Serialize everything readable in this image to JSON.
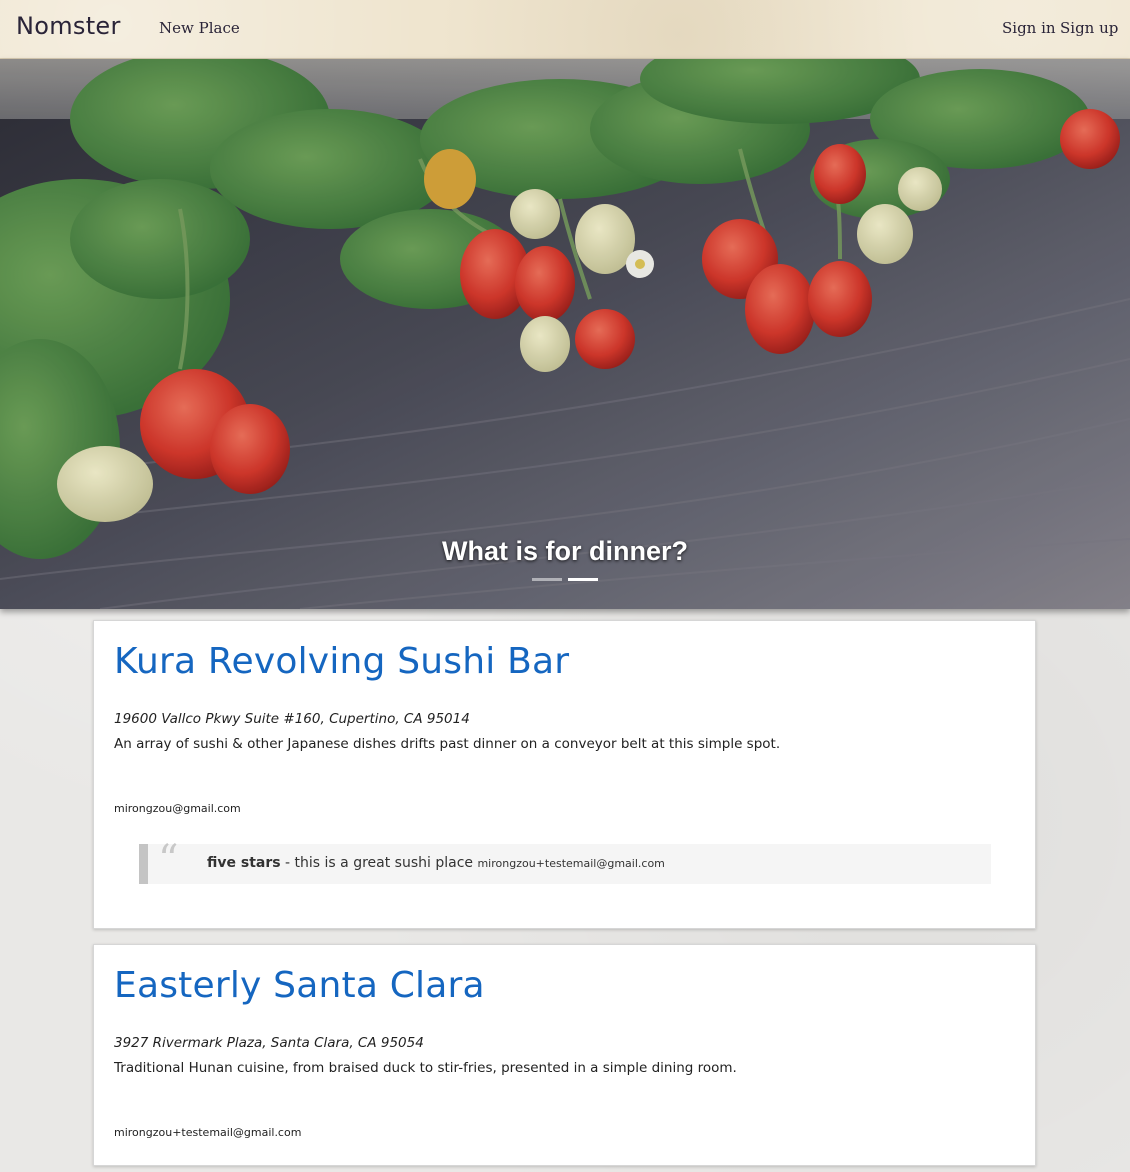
{
  "nav": {
    "brand": "Nomster",
    "new_place": "New Place",
    "sign_in": "Sign in",
    "sign_up": "Sign up"
  },
  "hero": {
    "caption": "What is for dinner?",
    "slide_count": 2,
    "active_slide": 2
  },
  "places": [
    {
      "name": "Kura Revolving Sushi Bar",
      "address": "19600 Vallco Pkwy Suite #160, Cupertino, CA 95014",
      "description": "An array of sushi & other Japanese dishes drifts past dinner on a conveyor belt at this simple spot.",
      "owner": "mirongzou@gmail.com",
      "comment": {
        "rating": "five stars",
        "message": " - this is a great sushi place ",
        "author": "mirongzou+testemail@gmail.com"
      }
    },
    {
      "name": "Easterly Santa Clara",
      "address": "3927 Rivermark Plaza, Santa Clara, CA 95054",
      "description": "Traditional Hunan cuisine, from braised duck to stir-fries, presented in a simple dining room.",
      "owner": "mirongzou+testemail@gmail.com"
    }
  ],
  "colors": {
    "navbar_bg": "#efe5cf",
    "link_blue": "#1566c0",
    "brand_text": "#2a2438"
  }
}
